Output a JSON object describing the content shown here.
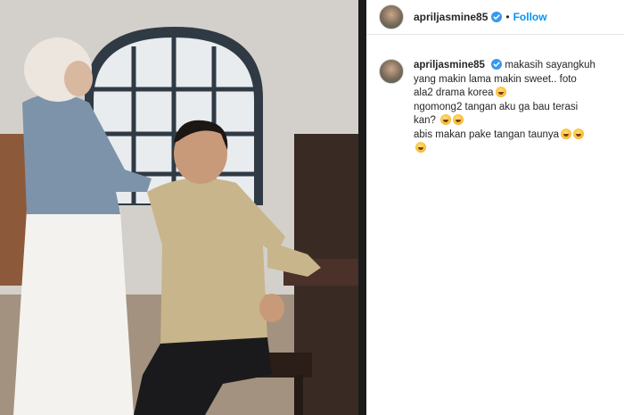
{
  "post": {
    "username": "apriljasmine85",
    "follow_label": "Follow",
    "separator": "•",
    "caption_lines": [
      "makasih sayangkuh",
      "yang makin lama makin sweet.. foto",
      "ala2 drama korea",
      "ngomong2 tangan aku ga bau terasi",
      "kan?",
      "abis makan pake tangan taunya"
    ]
  },
  "icons": {
    "verified": "verified-badge-icon",
    "emoji": "emoji-icon"
  },
  "colors": {
    "accent": "#0095f6",
    "verified": "#3897f0",
    "text": "#262626",
    "divider": "#1b1b1b"
  }
}
